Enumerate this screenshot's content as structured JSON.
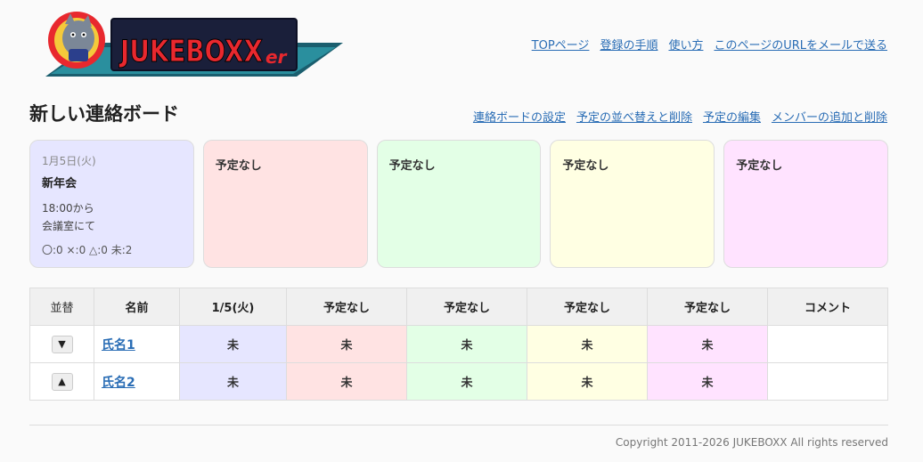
{
  "colors": {
    "card_bg": [
      "#e6e6ff",
      "#ffe3e3",
      "#e3ffe6",
      "#ffffe3",
      "#ffe3ff"
    ],
    "cell_bg": [
      "#e6e6ff",
      "#ffe3e3",
      "#e3ffe6",
      "#ffffe3",
      "#ffe3ff"
    ],
    "link": "#2a6db5"
  },
  "header": {
    "logo_text": "JUKEBOXX",
    "logo_suffix": "er",
    "nav": [
      "TOPページ",
      "登録の手順",
      "使い方",
      "このページのURLをメールで送る"
    ]
  },
  "board": {
    "title": "新しい連絡ボード",
    "links": [
      "連絡ボードの設定",
      "予定の並べ替えと削除",
      "予定の編集",
      "メンバーの追加と削除"
    ]
  },
  "cards": [
    {
      "date": "1月5日(火)",
      "title": "新年会",
      "line1": "18:00から",
      "line2": "会議室にて",
      "tally": "〇:0 ×:0 △:0 未:2"
    },
    {
      "none": "予定なし"
    },
    {
      "none": "予定なし"
    },
    {
      "none": "予定なし"
    },
    {
      "none": "予定なし"
    }
  ],
  "table": {
    "headers": [
      "並替",
      "名前",
      "1/5(火)",
      "予定なし",
      "予定なし",
      "予定なし",
      "予定なし",
      "コメント"
    ],
    "rows": [
      {
        "sort": "▼",
        "name": "氏名1",
        "marks": [
          "未",
          "未",
          "未",
          "未",
          "未"
        ],
        "comment": ""
      },
      {
        "sort": "▲",
        "name": "氏名2",
        "marks": [
          "未",
          "未",
          "未",
          "未",
          "未"
        ],
        "comment": ""
      }
    ]
  },
  "footer": {
    "copyright": "Copyright 2011-2026 JUKEBOXX All rights reserved"
  }
}
